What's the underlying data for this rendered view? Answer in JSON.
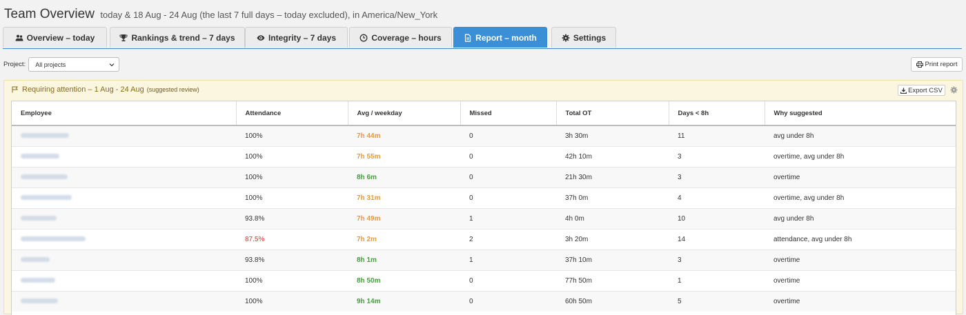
{
  "header": {
    "title": "Team Overview",
    "subtitle": "today & 18 Aug - 24 Aug (the last 7 full days – today excluded), in America/New_York"
  },
  "tabs": [
    {
      "label": "Overview – today",
      "icon": "users-icon",
      "active": false
    },
    {
      "label": "Rankings & trend – 7 days",
      "icon": "trophy-icon",
      "active": false
    },
    {
      "label": "Integrity – 7 days",
      "icon": "eye-icon",
      "active": false
    },
    {
      "label": "Coverage – hours",
      "icon": "clock-icon",
      "active": false
    },
    {
      "label": "Report – month",
      "icon": "file-icon",
      "active": true
    },
    {
      "label": "Settings",
      "icon": "gear-icon",
      "active": false
    }
  ],
  "filters": {
    "project_label": "Project:",
    "project_value": "All projects"
  },
  "toolbar": {
    "print_label": "Print report"
  },
  "attention": {
    "title": "Requiring attention – 1 Aug - 24 Aug",
    "hint": "(suggested review)",
    "export_label": "Export CSV"
  },
  "table": {
    "columns": [
      "Employee",
      "Attendance",
      "Avg / weekday",
      "Missed",
      "Total OT",
      "Days < 8h",
      "Why suggested"
    ],
    "rows": [
      {
        "attendance": "100%",
        "attendance_status": "normal",
        "avg": "7h 44m",
        "avg_status": "warn",
        "missed": "0",
        "ot": "3h 30m",
        "days": "11",
        "why": "avg under 8h"
      },
      {
        "attendance": "100%",
        "attendance_status": "normal",
        "avg": "7h 55m",
        "avg_status": "warn",
        "missed": "0",
        "ot": "42h 10m",
        "days": "3",
        "why": "overtime, avg under 8h"
      },
      {
        "attendance": "100%",
        "attendance_status": "normal",
        "avg": "8h 6m",
        "avg_status": "good",
        "missed": "0",
        "ot": "21h 30m",
        "days": "3",
        "why": "overtime"
      },
      {
        "attendance": "100%",
        "attendance_status": "normal",
        "avg": "7h 31m",
        "avg_status": "warn",
        "missed": "0",
        "ot": "37h 0m",
        "days": "4",
        "why": "overtime, avg under 8h"
      },
      {
        "attendance": "93.8%",
        "attendance_status": "normal",
        "avg": "7h 49m",
        "avg_status": "warn",
        "missed": "1",
        "ot": "4h 0m",
        "days": "10",
        "why": "avg under 8h"
      },
      {
        "attendance": "87.5%",
        "attendance_status": "bad",
        "avg": "7h 2m",
        "avg_status": "warn",
        "missed": "2",
        "ot": "3h 20m",
        "days": "14",
        "why": "attendance, avg under 8h"
      },
      {
        "attendance": "93.8%",
        "attendance_status": "normal",
        "avg": "8h 1m",
        "avg_status": "good",
        "missed": "1",
        "ot": "37h 10m",
        "days": "3",
        "why": "overtime"
      },
      {
        "attendance": "100%",
        "attendance_status": "normal",
        "avg": "8h 50m",
        "avg_status": "good",
        "missed": "0",
        "ot": "77h 50m",
        "days": "1",
        "why": "overtime"
      },
      {
        "attendance": "100%",
        "attendance_status": "normal",
        "avg": "9h 14m",
        "avg_status": "good",
        "missed": "0",
        "ot": "60h 50m",
        "days": "5",
        "why": "overtime"
      }
    ]
  },
  "colors": {
    "accent": "#3a8fd6",
    "warn": "#ea9b2e",
    "good": "#43a13a",
    "bad": "#d9352a",
    "attention_bg": "#fbf6df"
  }
}
